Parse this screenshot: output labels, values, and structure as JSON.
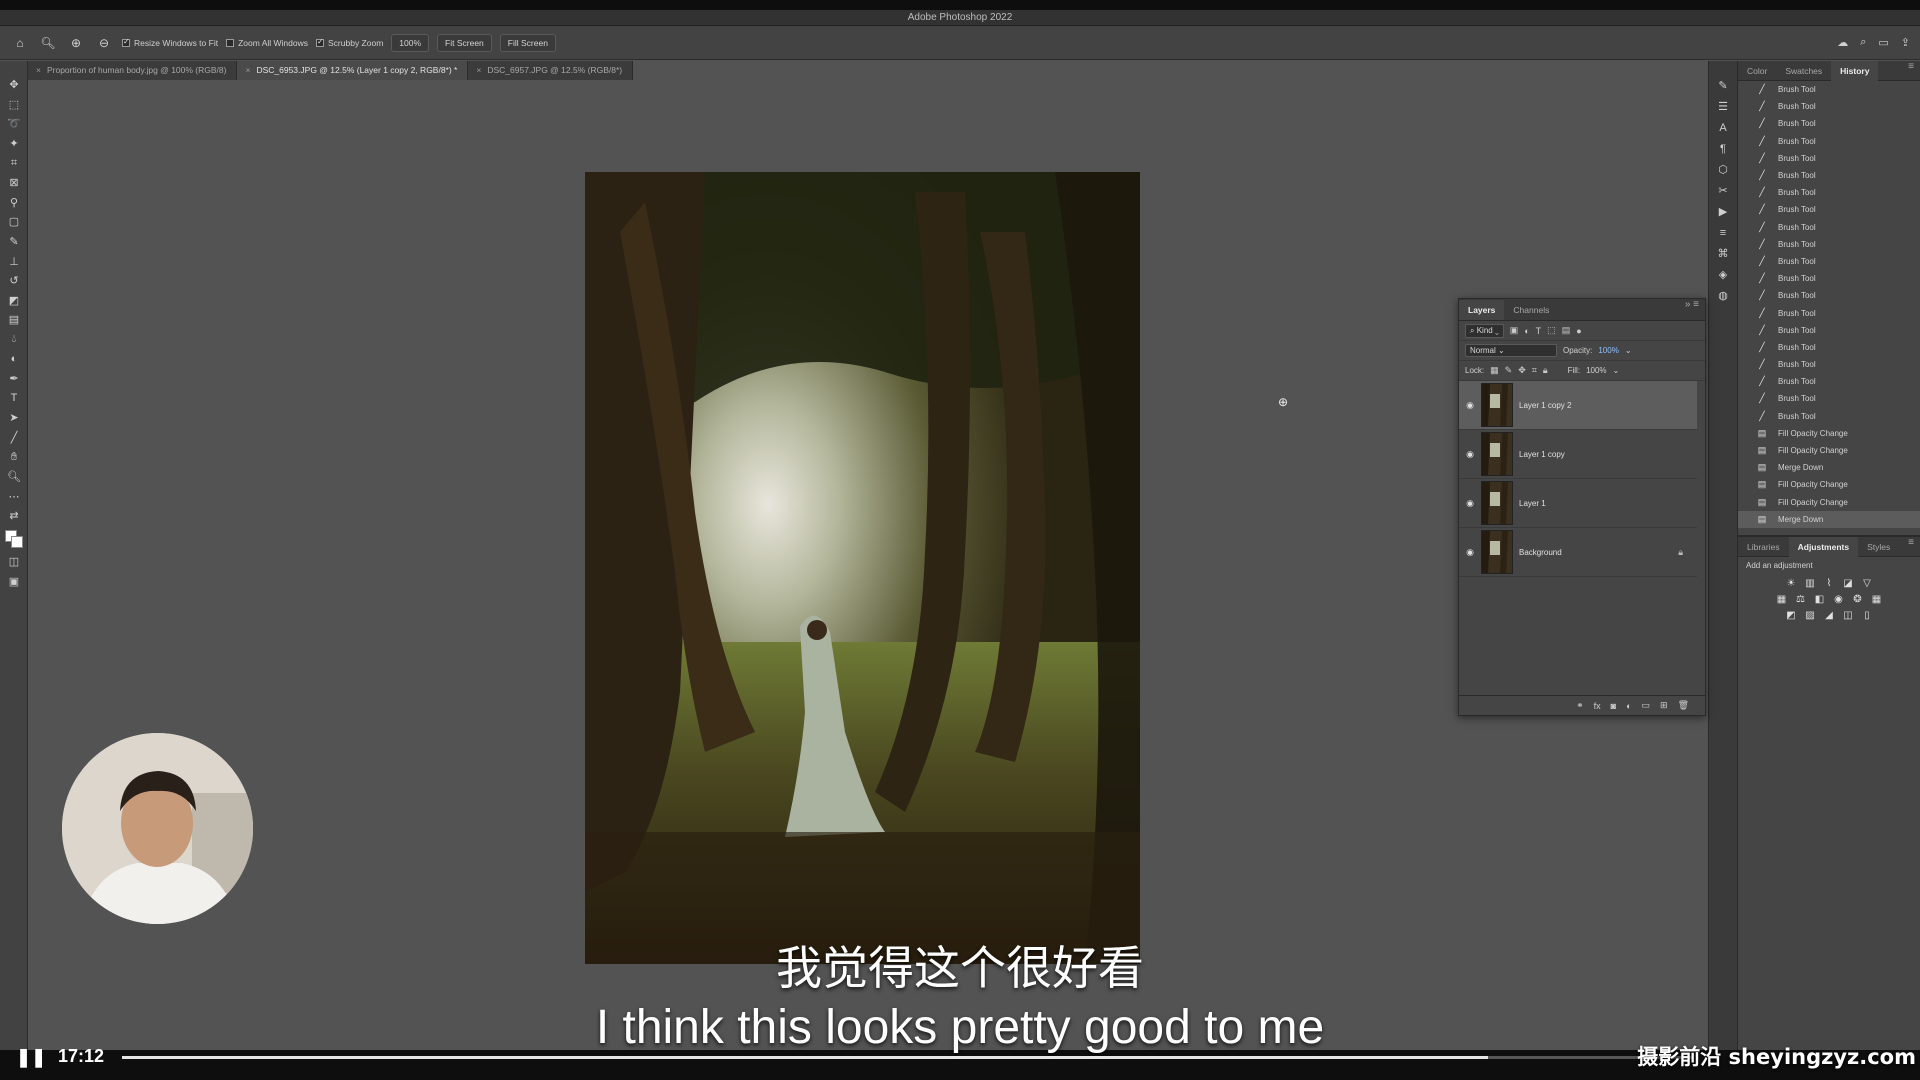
{
  "app": {
    "title": "Adobe Photoshop 2022"
  },
  "options_bar": {
    "resize_windows_label": "Resize Windows to Fit",
    "zoom_all_label": "Zoom All Windows",
    "scrubby_zoom_label": "Scrubby Zoom",
    "zoom_value": "100%",
    "fit_screen_label": "Fit Screen",
    "fill_screen_label": "Fill Screen"
  },
  "doc_tabs": [
    {
      "label": "Proportion of human body.jpg @ 100% (RGB/8)",
      "active": false
    },
    {
      "label": "DSC_6953.JPG @ 12.5% (Layer 1 copy 2, RGB/8*) *",
      "active": true
    },
    {
      "label": "DSC_6957.JPG @ 12.5% (RGB/8*)",
      "active": false
    }
  ],
  "history_panel": {
    "tabs": [
      "Color",
      "Swatches",
      "History"
    ],
    "active_tab": "History",
    "items": [
      "Brush Tool",
      "Brush Tool",
      "Brush Tool",
      "Brush Tool",
      "Brush Tool",
      "Brush Tool",
      "Brush Tool",
      "Brush Tool",
      "Brush Tool",
      "Brush Tool",
      "Brush Tool",
      "Brush Tool",
      "Brush Tool",
      "Brush Tool",
      "Brush Tool",
      "Brush Tool",
      "Brush Tool",
      "Brush Tool",
      "Brush Tool",
      "Brush Tool",
      "Fill Opacity Change",
      "Fill Opacity Change",
      "Merge Down",
      "Fill Opacity Change",
      "Fill Opacity Change",
      "Merge Down"
    ]
  },
  "adjustments_panel": {
    "tabs": [
      "Libraries",
      "Adjustments",
      "Styles"
    ],
    "active_tab": "Adjustments",
    "hint": "Add an adjustment"
  },
  "layers_panel": {
    "tabs": [
      "Layers",
      "Channels"
    ],
    "filter_label": "Kind",
    "blend_mode": "Normal",
    "opacity_label": "Opacity:",
    "opacity_value": "100%",
    "lock_label": "Lock:",
    "fill_label": "Fill:",
    "fill_value": "100%",
    "layers": [
      {
        "name": "Layer 1 copy 2",
        "selected": true,
        "locked": false
      },
      {
        "name": "Layer 1 copy",
        "selected": false,
        "locked": false
      },
      {
        "name": "Layer 1",
        "selected": false,
        "locked": false
      },
      {
        "name": "Background",
        "selected": false,
        "locked": true
      }
    ]
  },
  "subtitles": {
    "chinese": "我觉得这个很好看",
    "english": "I think this looks pretty good to me"
  },
  "player": {
    "time": "17:12",
    "progress": 0.87,
    "watermark": "摄影前沿 sheyingzyz.com"
  }
}
